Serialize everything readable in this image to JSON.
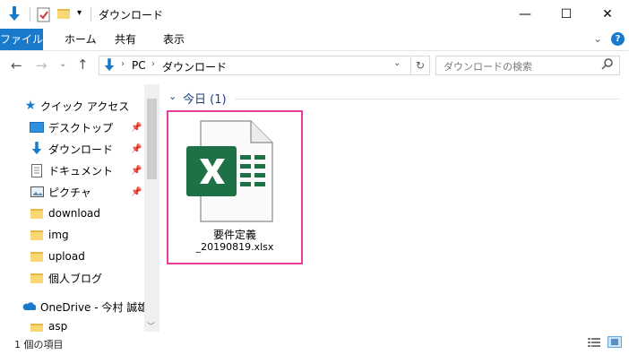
{
  "window": {
    "title": "ダウンロード",
    "minimize_glyph": "—",
    "maximize_glyph": "☐",
    "close_glyph": "✕"
  },
  "ribbon": {
    "tabs": [
      "ファイル",
      "ホーム",
      "共有",
      "表示"
    ],
    "help_glyph": "?"
  },
  "address": {
    "breadcrumb": [
      "PC",
      "ダウンロード"
    ],
    "search_placeholder": "ダウンロードの検索"
  },
  "nav": {
    "quick_access": "クイック アクセス",
    "items": [
      {
        "label": "デスクトップ",
        "icon": "desktop-icon",
        "pinned": true
      },
      {
        "label": "ダウンロード",
        "icon": "download-icon",
        "pinned": true
      },
      {
        "label": "ドキュメント",
        "icon": "document-icon",
        "pinned": true
      },
      {
        "label": "ピクチャ",
        "icon": "picture-icon",
        "pinned": true
      },
      {
        "label": "download",
        "icon": "folder-icon",
        "pinned": false
      },
      {
        "label": "img",
        "icon": "folder-icon",
        "pinned": false
      },
      {
        "label": "upload",
        "icon": "folder-icon",
        "pinned": false
      },
      {
        "label": "個人ブログ",
        "icon": "folder-icon",
        "pinned": false
      }
    ],
    "onedrive": "OneDrive - 今村 誠雄",
    "onedrive_sub": "asp"
  },
  "content": {
    "group_header": "今日 (1)",
    "file": {
      "name_line1": "要件定義",
      "name_line2": "_20190819.xlsx",
      "icon": "excel-file-icon"
    }
  },
  "status": {
    "text": "1 個の項目"
  },
  "colors": {
    "accent": "#1979ca",
    "selection_border": "#e83e9d",
    "excel_green": "#1e7145"
  }
}
